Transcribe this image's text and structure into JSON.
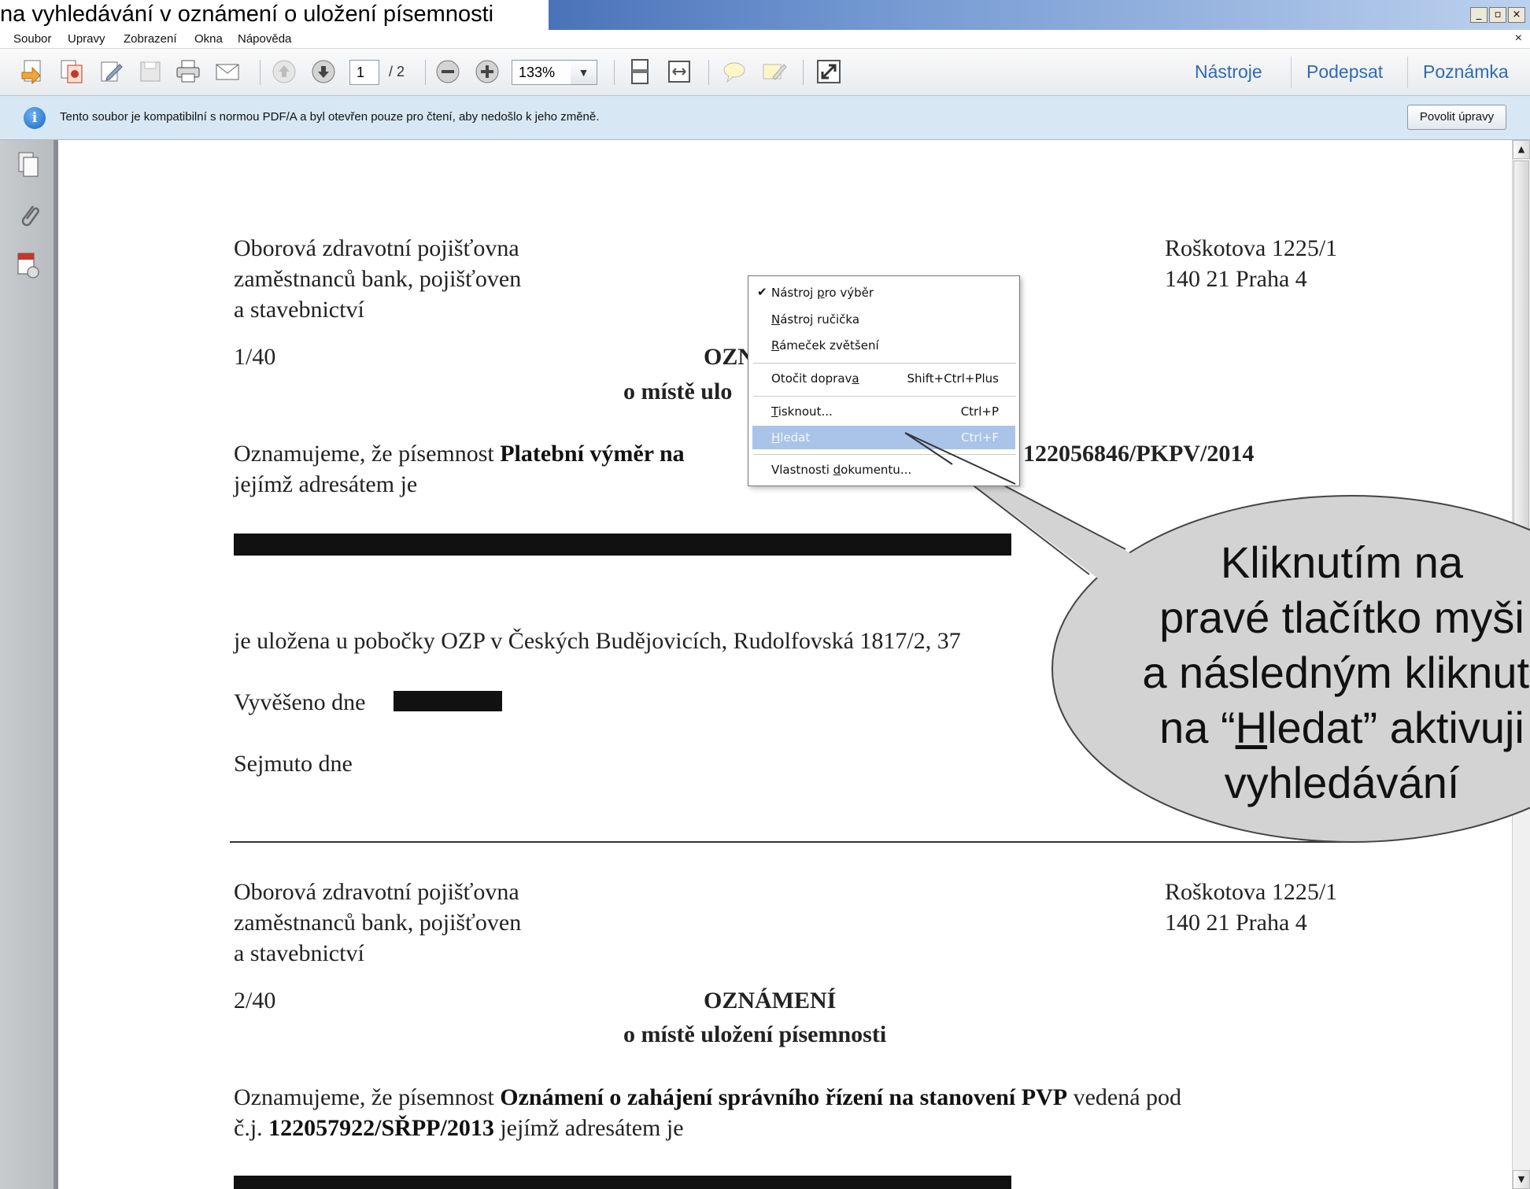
{
  "window": {
    "title": "na vyhledávání v oznámení o uložení písemnosti",
    "buttons": [
      "_",
      "▫",
      "×"
    ]
  },
  "menu": {
    "items": [
      "Soubor",
      "Upravy",
      "Zobrazení",
      "Okna",
      "Nápověda"
    ],
    "close": "×"
  },
  "toolbar": {
    "page_current": "1",
    "page_total": "/ 2",
    "zoom": "133%",
    "zoom_dropdown": "▼",
    "links": [
      "Nástroje",
      "Podepsat",
      "Poznámka"
    ],
    "icons": [
      "create-pdf-icon",
      "combine-icon",
      "edit-icon",
      "save-icon",
      "print-icon",
      "email-icon",
      "page-up-icon",
      "page-down-icon",
      "zoom-out-icon",
      "zoom-in-icon",
      "fit-page-icon",
      "fit-width-icon",
      "comment-icon",
      "highlight-icon",
      "fullscreen-icon"
    ]
  },
  "infobar": {
    "text": "Tento soubor je kompatibilní s normou PDF/A a byl otevřen pouze pro čtení, aby nedošlo k jeho změně.",
    "button": "Povolit úpravy"
  },
  "scrollbar": {
    "up": "▲",
    "down": "▼"
  },
  "document": {
    "block1": {
      "sender_l1": "Oborová zdravotní pojišťovna",
      "sender_l2": "zaměstnanců bank, pojišťoven",
      "sender_l3": "a stavebnictví",
      "addr_l1": "Roškotova 1225/1",
      "addr_l2": "140 21  Praha 4",
      "number": "1/40",
      "heading_partial": "OZN",
      "subheading_partial": "o místě ulo",
      "body_l1_prefix": "Oznamujeme, že písemnost ",
      "body_l1_bold": "Platební výměr na",
      "body_l1_right": "122056846/PKPV/2014",
      "body_l2": "jejímž adresátem je",
      "stored_at": "je uložena u pobočky OZP v Českých Budějovicích, Rudolfovská 1817/2, 37",
      "posted": "Vyvěšeno dne",
      "removed": "Sejmuto dne"
    },
    "block2": {
      "sender_l1": "Oborová zdravotní pojišťovna",
      "sender_l2": "zaměstnanců bank, pojišťoven",
      "sender_l3": "a stavebnictví",
      "addr_l1": "Roškotova 1225/1",
      "addr_l2": "140 21  Praha 4",
      "number": "2/40",
      "heading": "OZNÁMENÍ",
      "subheading": "o místě uložení písemnosti",
      "body_l1_prefix": "Oznamujeme, že písemnost ",
      "body_l1_bold": "Oznámení o zahájení správního řízení na stanovení PVP",
      "body_l1_suffix": " vedená pod",
      "body_l2_prefix": "č.j. ",
      "body_l2_bold": "122057922/SŘPP/2013",
      "body_l2_suffix": " jejímž adresátem je"
    }
  },
  "context_menu": {
    "items": [
      {
        "check": "✔",
        "pre": "Nástroj ",
        "u": "p",
        "post": "ro výběr",
        "shortcut": ""
      },
      {
        "check": "",
        "pre": "",
        "u": "N",
        "post": "ástroj ručička",
        "shortcut": ""
      },
      {
        "check": "",
        "pre": "",
        "u": "R",
        "post": "ámeček zvětšení",
        "shortcut": ""
      },
      {
        "check": "",
        "pre": "Otočit doprav",
        "u": "a",
        "post": "",
        "shortcut": "Shift+Ctrl+Plus"
      },
      {
        "check": "",
        "pre": "",
        "u": "T",
        "post": "isknout...",
        "shortcut": "Ctrl+P"
      },
      {
        "check": "",
        "pre": "",
        "u": "H",
        "post": "ledat",
        "shortcut": "Ctrl+F"
      },
      {
        "check": "",
        "pre": "Vlastnosti ",
        "u": "d",
        "post": "okumentu...",
        "shortcut": ""
      }
    ]
  },
  "callout": {
    "l1": "Kliknutím na",
    "l2": "pravé tlačítko myši",
    "l3": "a následným kliknutí",
    "l4_pre": "na “",
    "l4_u": "H",
    "l4_post": "ledat” aktivuji",
    "l5": "vyhledávání"
  }
}
